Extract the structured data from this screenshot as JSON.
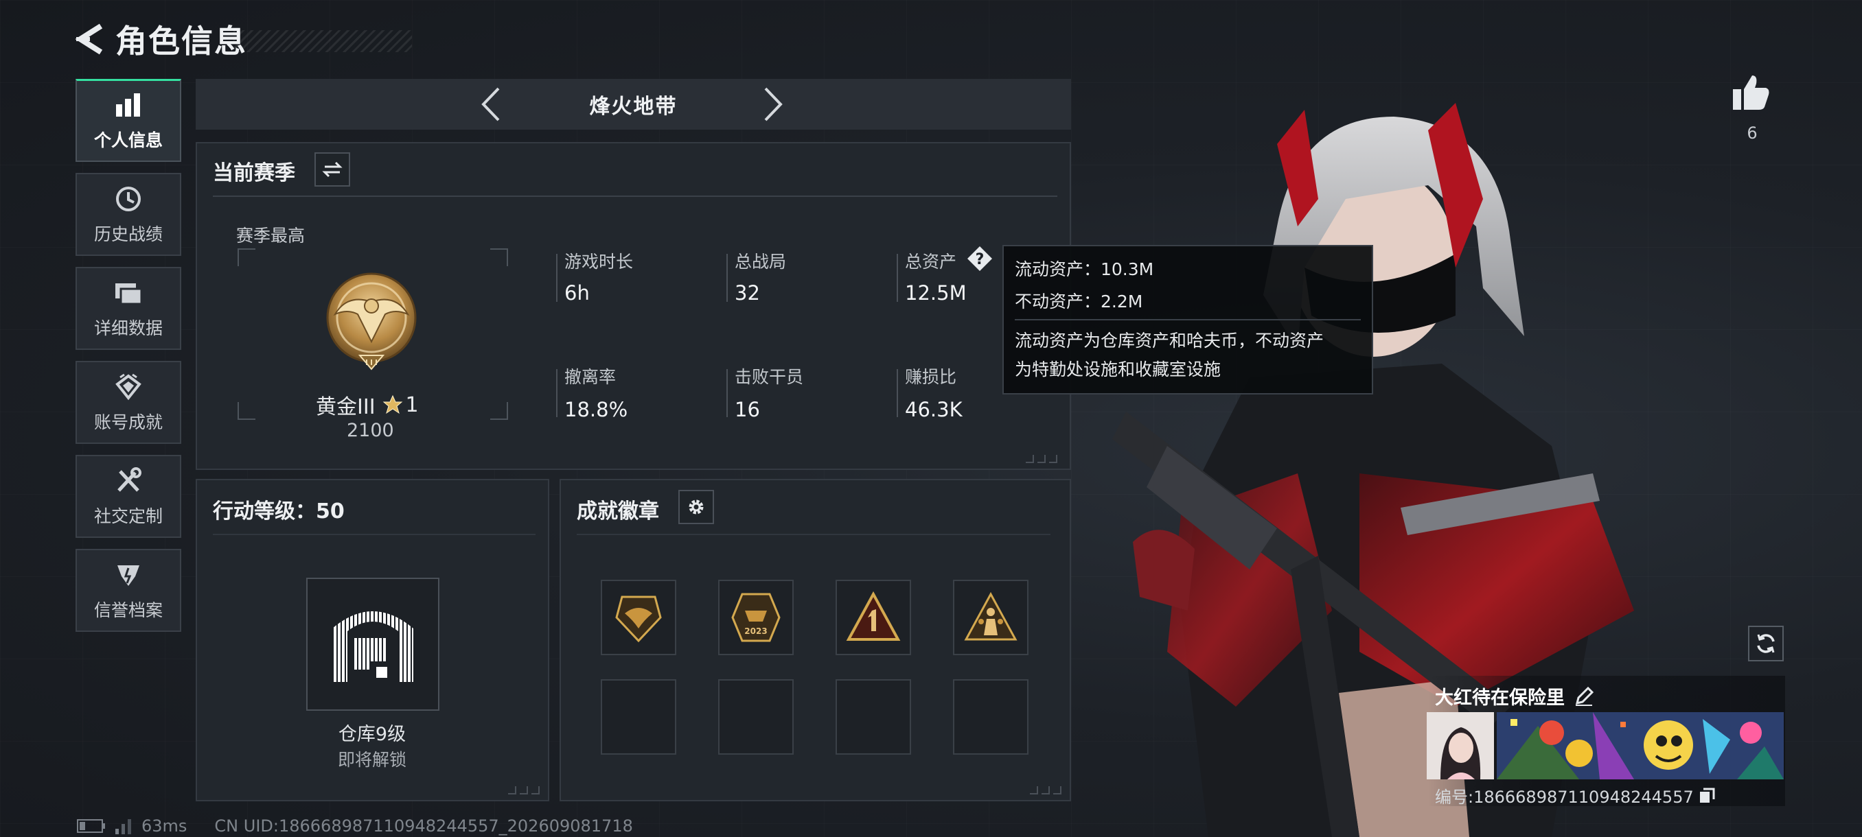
{
  "header": {
    "title": "角色信息"
  },
  "sidebar": {
    "items": [
      {
        "label": "个人信息",
        "icon": "bar-chart-icon",
        "active": true
      },
      {
        "label": "历史战绩",
        "icon": "clock-icon"
      },
      {
        "label": "详细数据",
        "icon": "folder-icon"
      },
      {
        "label": "账号成就",
        "icon": "achievement-icon"
      },
      {
        "label": "社交定制",
        "icon": "tools-icon"
      },
      {
        "label": "信誉档案",
        "icon": "shield-icon"
      }
    ]
  },
  "mode_nav": {
    "label": "烽火地带"
  },
  "season": {
    "title": "当前赛季",
    "best_label": "赛季最高",
    "rank_name": "黄金III",
    "rank_stars": "1",
    "rank_score": "2100",
    "stats": [
      {
        "label": "游戏时长",
        "value": "6h"
      },
      {
        "label": "总战局",
        "value": "32"
      },
      {
        "label": "总资产",
        "value": "12.5M"
      },
      {
        "label": "撤离率",
        "value": "18.8%"
      },
      {
        "label": "击败干员",
        "value": "16"
      },
      {
        "label": "赚损比",
        "value": "46.3K"
      }
    ]
  },
  "tooltip": {
    "liquid": "流动资产：10.3M",
    "fixed": "不动资产：2.2M",
    "desc_line1": "流动资产为仓库资产和哈夫币，不动资产",
    "desc_line2": "为特勤处设施和收藏室设施"
  },
  "action_level": {
    "title": "行动等级：50",
    "unlock_name": "仓库9级",
    "unlock_status": "即将解锁"
  },
  "badges": {
    "title": "成就徽章",
    "badge_year": "2023"
  },
  "likes": {
    "count": "6"
  },
  "profile": {
    "name": "大红待在保险里",
    "id_text": "编号:186668987110948244557"
  },
  "status_bar": {
    "ping": "63ms",
    "uid": "CN UID:186668987110948244557_202609081718"
  },
  "colors": {
    "accent": "#35e0a0",
    "gold": "#c8a25a",
    "bg": "#1b1f25",
    "panel": "#22272d"
  }
}
